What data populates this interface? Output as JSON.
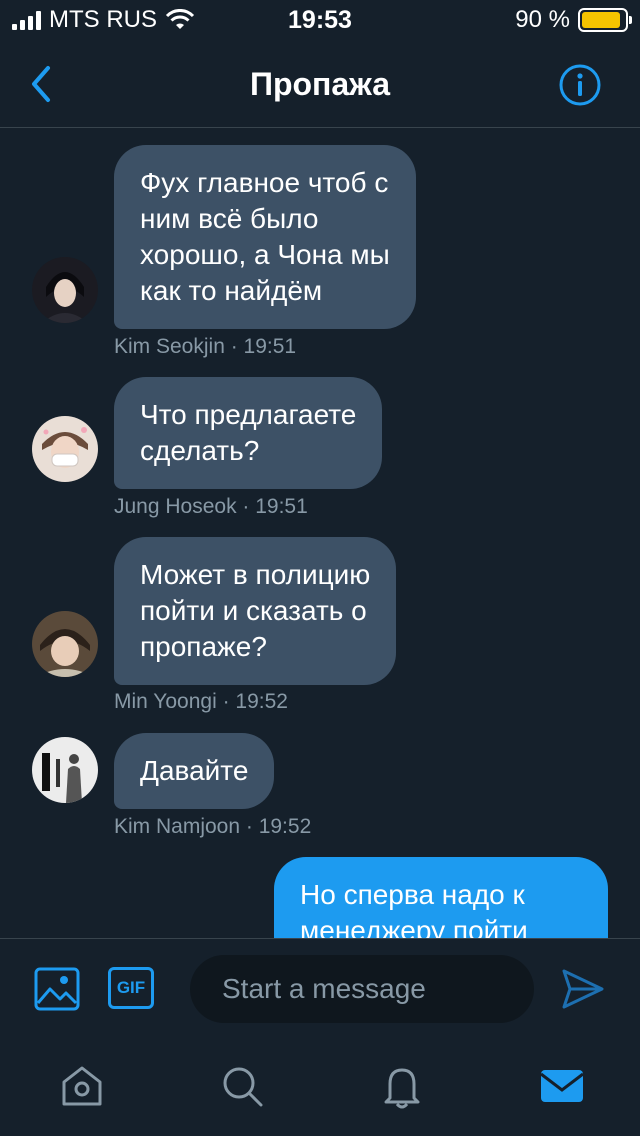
{
  "status_bar": {
    "carrier": "MTS RUS",
    "time": "19:53",
    "battery": "90 %",
    "battery_level": 0.9
  },
  "header": {
    "title": "Пропажа",
    "back_icon": "chevron-left-icon",
    "info_icon": "info-icon"
  },
  "messages": [
    {
      "lines": [
        "Фух главное чтоб с",
        "ним всё было",
        "хорошо, а Чона мы",
        "как то найдём"
      ],
      "meta": "Kim Seokjin · 19:51"
    },
    {
      "lines": [
        "Что предлагаете",
        "сделать?"
      ],
      "meta": "Jung Hoseok · 19:51"
    },
    {
      "lines": [
        "Может в полицию",
        "пойти и сказать о",
        "пропаже?"
      ],
      "meta": "Min Yoongi · 19:52"
    },
    {
      "lines": [
        "Давайте"
      ],
      "meta": "Kim Namjoon · 19:52"
    },
    {
      "lines": [
        "Но сперва надо к",
        "менеджеру пойти"
      ],
      "outgoing": true
    }
  ],
  "composer": {
    "placeholder": "Start a message",
    "image_icon": "image-icon",
    "gif_label": "GIF",
    "send_icon": "send-icon"
  },
  "tabbar": {
    "items": [
      "home-icon",
      "search-icon",
      "notifications-icon",
      "messages-icon"
    ],
    "active": "messages-icon"
  },
  "colors": {
    "background": "#15202b",
    "bubble_incoming": "#3d5166",
    "bubble_outgoing": "#1d9bf0",
    "accent": "#1d9bf0",
    "muted_text": "#8899a6"
  }
}
